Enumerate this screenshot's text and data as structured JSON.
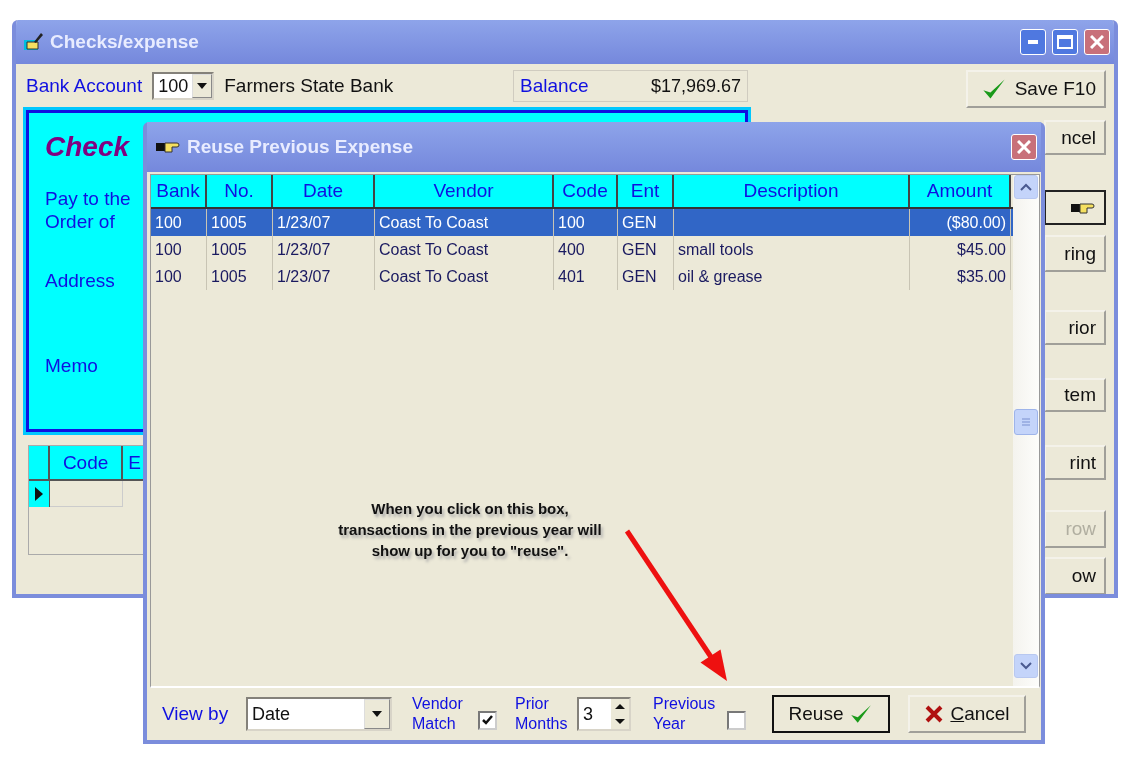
{
  "main_window": {
    "title": "Checks/expense",
    "bank_account_label": "Bank Account",
    "bank_account": "100",
    "bank_name": "Farmers State Bank",
    "balance_label": "Balance",
    "balance": "$17,969.67",
    "check_panel": {
      "title": "Check",
      "labels": [
        "Pay to the Order of",
        "Address",
        "Memo"
      ]
    },
    "grid": {
      "columns": [
        "Code",
        "E"
      ]
    },
    "buttons": [
      {
        "kind": "save",
        "label": "Save F10",
        "disabled": false
      },
      {
        "kind": "text",
        "label": "ncel",
        "disabled": false
      },
      {
        "kind": "hand",
        "disabled": false
      },
      {
        "kind": "text",
        "label": "ring",
        "disabled": false
      },
      {
        "kind": "text",
        "label": "rior",
        "disabled": false
      },
      {
        "kind": "text",
        "label": "tem",
        "disabled": false
      },
      {
        "kind": "text",
        "label": "rint",
        "disabled": false
      },
      {
        "kind": "text",
        "label": "row",
        "disabled": true
      },
      {
        "kind": "text",
        "label": "ow",
        "disabled": false
      }
    ]
  },
  "dialog": {
    "title": "Reuse Previous Expense",
    "columns": [
      "Bank",
      "No.",
      "Date",
      "Vendor",
      "Code",
      "Ent",
      "Description",
      "Amount"
    ],
    "rows": [
      {
        "cells": [
          "100",
          "1005",
          "1/23/07",
          "Coast To Coast",
          "100",
          "GEN",
          "",
          "($80.00)"
        ],
        "selected": true
      },
      {
        "cells": [
          "100",
          "1005",
          "1/23/07",
          "Coast To Coast",
          "400",
          "GEN",
          "small tools",
          "$45.00"
        ],
        "selected": false
      },
      {
        "cells": [
          "100",
          "1005",
          "1/23/07",
          "Coast To Coast",
          "401",
          "GEN",
          "oil & grease",
          "$35.00"
        ],
        "selected": false
      }
    ],
    "view_by_label": "View by",
    "view_by": "Date",
    "vendor_match_label": "Vendor Match",
    "vendor_match": true,
    "prior_months_label": "Prior Months",
    "prior_months": "3",
    "previous_year_label": "Previous Year",
    "previous_year": false,
    "reuse_button": "Reuse",
    "cancel_button": "Cancel"
  },
  "annotation": "When you click on this box, transactions in the previous year will show up for you to \"reuse\"."
}
